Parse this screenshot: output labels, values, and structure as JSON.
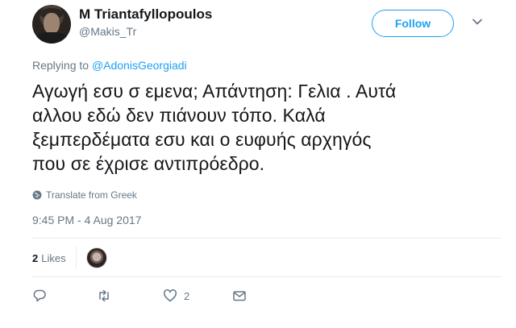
{
  "user": {
    "name": "M Triantafyllopoulos",
    "handle": "@Makis_Tr"
  },
  "follow_label": "Follow",
  "reply": {
    "prefix": "Replying to",
    "mention": "@AdonisGeorgiadi"
  },
  "tweet": {
    "lines": [
      "Αγωγή εσυ σ εμενα; Απάντηση: Γελια . Αυτά",
      "αλλου εδώ δεν πιάνουν τόπο. Καλά",
      "ξεμπερδέματα εσυ και ο ευφυής αρχηγός",
      "που σε έχρισε αντιπρόεδρο."
    ]
  },
  "translate_label": "Translate from Greek",
  "timestamp": "9:45 PM - 4 Aug 2017",
  "likes": {
    "count": "2",
    "label": "Likes"
  },
  "actions": {
    "like_count": "2"
  },
  "colors": {
    "accent": "#1da1f2",
    "secondary_text": "#657786",
    "divider": "#e6ecf0"
  },
  "icons": [
    "chevron-down-icon",
    "globe-icon",
    "reply-icon",
    "retweet-icon",
    "heart-icon",
    "message-icon"
  ]
}
